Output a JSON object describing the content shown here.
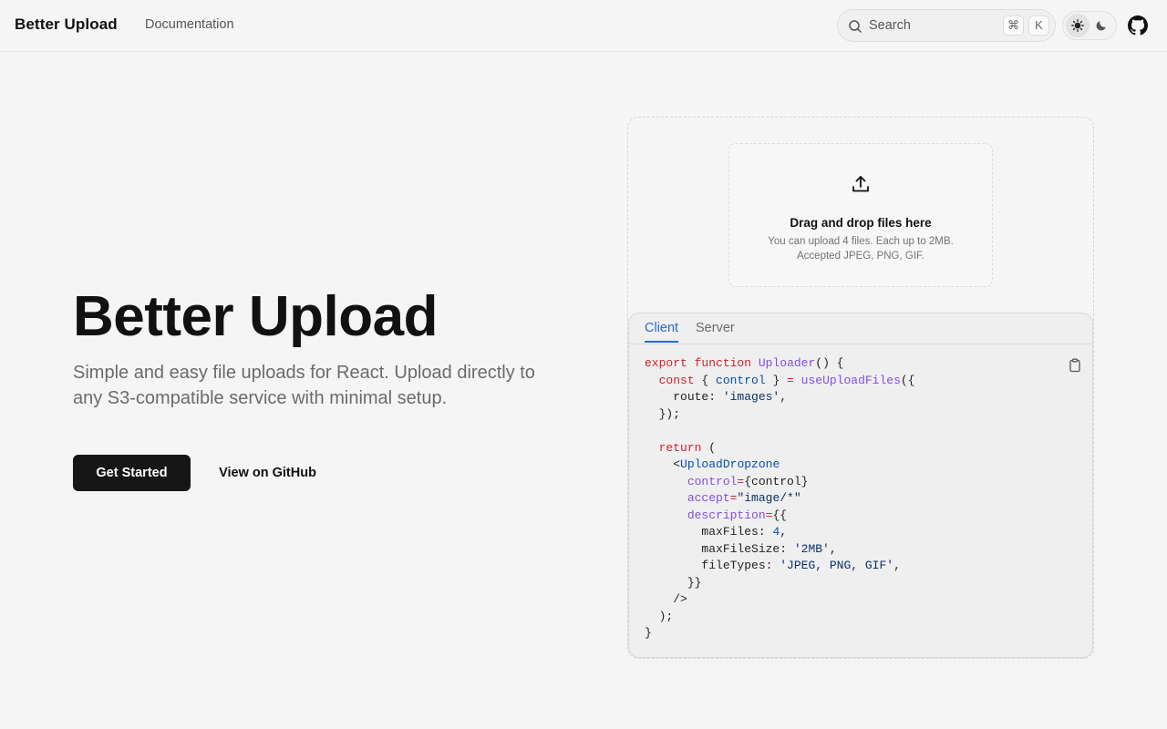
{
  "header": {
    "brand": "Better Upload",
    "nav_documentation": "Documentation",
    "search_label": "Search",
    "search_kbd_1": "⌘",
    "search_kbd_2": "K",
    "theme_light_icon": "sun-icon",
    "theme_dark_icon": "moon-icon",
    "github_icon": "github-icon"
  },
  "hero": {
    "title": "Better Upload",
    "description": "Simple and easy file uploads for React. Upload directly to any S3-compatible service with minimal setup.",
    "primary_button": "Get Started",
    "secondary_button": "View on GitHub"
  },
  "dropzone": {
    "icon": "upload-icon",
    "title": "Drag and drop files here",
    "line1": "You can upload 4 files. Each up to 2MB.",
    "line2": "Accepted JPEG, PNG, GIF."
  },
  "code_card": {
    "tabs": [
      {
        "label": "Client",
        "active": true
      },
      {
        "label": "Server",
        "active": false
      }
    ],
    "copy_icon": "clipboard-icon",
    "code": {
      "l1_kw1": "export",
      "l1_kw2": "function",
      "l1_fn": "Uploader",
      "l1_rest": "() {",
      "l2_kw": "const",
      "l2_open": " { ",
      "l2_id": "control",
      "l2_close": " } ",
      "l2_eq": "=",
      "l2_fn": "useUploadFiles",
      "l2_rest": "({",
      "l3_key": "route: ",
      "l3_str": "'images'",
      "l3_rest": ",",
      "l4": "});",
      "l6_kw": "return",
      "l6_rest": " (",
      "l7_lt": "<",
      "l7_tag": "UploadDropzone",
      "l8_attr": "control",
      "l8_eq": "=",
      "l8_val": "{control}",
      "l9_attr": "accept",
      "l9_eq": "=",
      "l9_str": "\"image/*\"",
      "l10_attr": "description",
      "l10_eq": "=",
      "l10_rest": "{{",
      "l11_key": "maxFiles: ",
      "l11_num": "4",
      "l11_rest": ",",
      "l12_key": "maxFileSize: ",
      "l12_str": "'2MB'",
      "l12_rest": ",",
      "l13_key": "fileTypes: ",
      "l13_str": "'JPEG, PNG, GIF'",
      "l13_rest": ",",
      "l14": "}}",
      "l15": "/>",
      "l16": ");",
      "l17": "}"
    }
  }
}
